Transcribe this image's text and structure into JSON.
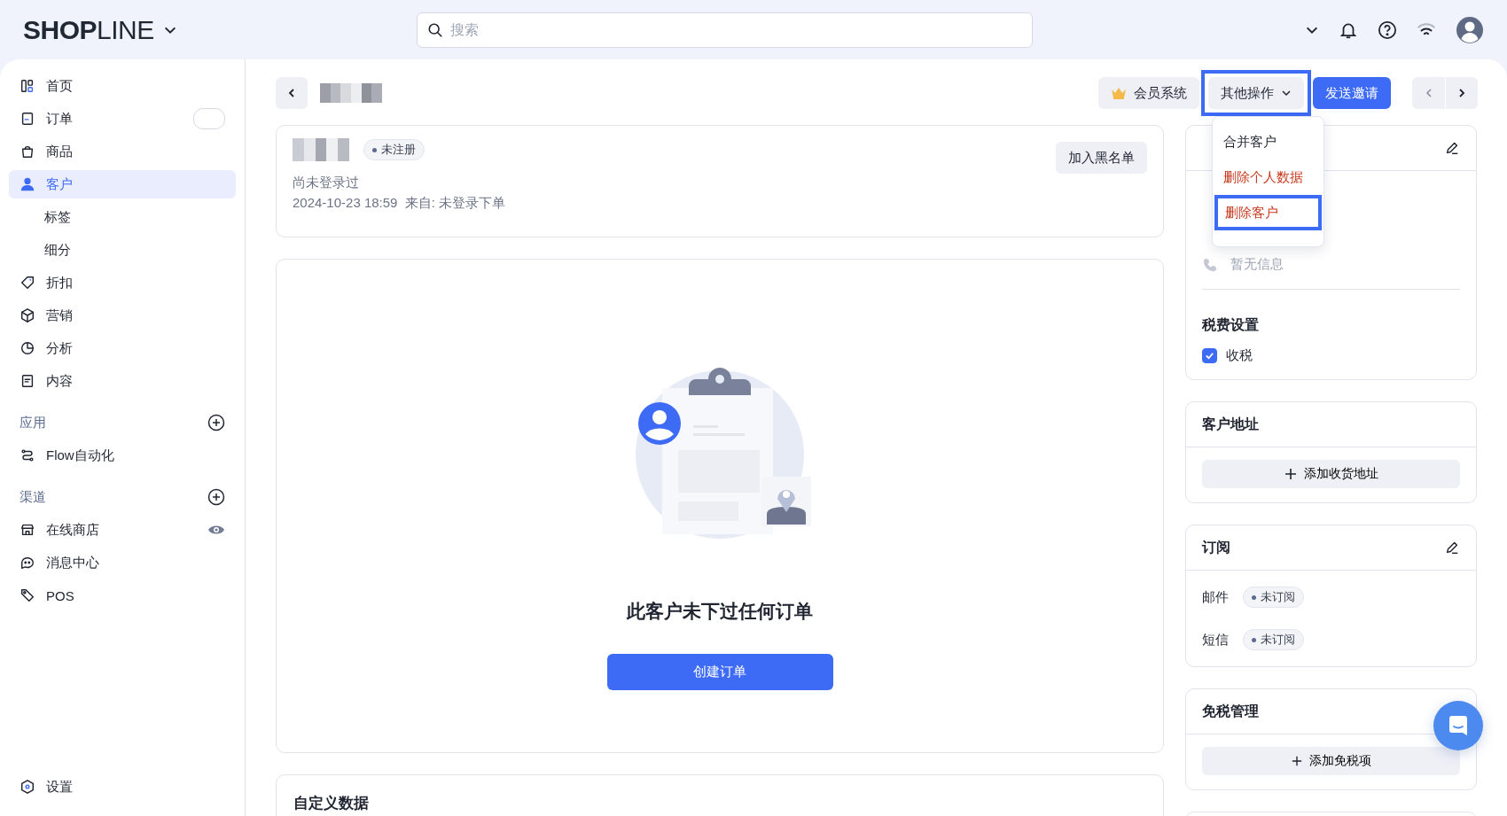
{
  "topbar": {
    "logo": "**SHOP**LINE",
    "search": {
      "placeholder": "搜索"
    }
  },
  "sidebar": {
    "items": [
      {
        "kind": "item",
        "label": "首页",
        "selected": false
      },
      {
        "kind": "item",
        "label": "订单",
        "selected": false
      },
      {
        "kind": "item",
        "label": "商品",
        "selected": false
      },
      {
        "kind": "item",
        "label": "客户",
        "selected": true
      },
      {
        "kind": "subitem",
        "label": "标签",
        "selected": false
      },
      {
        "kind": "subitem",
        "label": "细分",
        "selected": false
      },
      {
        "kind": "item",
        "label": "折扣",
        "selected": false
      },
      {
        "kind": "item",
        "label": "营销",
        "selected": false
      },
      {
        "kind": "item",
        "label": "分析",
        "selected": false
      },
      {
        "kind": "item",
        "label": "内容",
        "selected": false
      },
      {
        "kind": "section",
        "label": "应用"
      },
      {
        "kind": "item",
        "label": "Flow自动化",
        "selected": false
      },
      {
        "kind": "section",
        "label": "渠道"
      },
      {
        "kind": "item",
        "label": "在线商店",
        "selected": false
      },
      {
        "kind": "item",
        "label": "消息中心",
        "selected": false
      },
      {
        "kind": "item",
        "label": "POS",
        "selected": false
      }
    ],
    "footer": {
      "label": "设置",
      "selected": false
    }
  },
  "toolbar": {
    "buttons": [
      {
        "kind": "secondary",
        "label": "会员系统",
        "highlighted": false
      },
      {
        "kind": "menu",
        "label": "其他操作",
        "highlighted": true
      },
      {
        "kind": "primary",
        "label": "发送邀请",
        "highlighted": false
      }
    ],
    "menu": [
      {
        "label": "合并客户",
        "danger": false,
        "highlighted": false
      },
      {
        "label": "删除个人数据",
        "danger": true,
        "highlighted": false
      },
      {
        "label": "删除客户",
        "danger": true,
        "highlighted": true
      }
    ]
  },
  "customer": {
    "status": "未注册",
    "login": "尚未登录过",
    "meta": "2024-10-23 18:59  来自: 未登录下单",
    "blacklist_button": "加入黑名单"
  },
  "orders": {
    "message": "此客户未下过任何订单",
    "button": "创建订单"
  },
  "custom_data": {
    "title": "自定义数据"
  },
  "contact": {
    "phone": "暂无信息",
    "tax_title": "税费设置",
    "tax_option": {
      "label": "收税",
      "checked": true
    }
  },
  "address": {
    "title": "客户地址",
    "button": "添加收货地址"
  },
  "subscription": {
    "title": "订阅",
    "rows": [
      {
        "label": "邮件",
        "status": "未订阅"
      },
      {
        "label": "短信",
        "status": "未订阅"
      }
    ]
  },
  "tax_exempt": {
    "title": "免税管理",
    "button": "添加免税项"
  }
}
